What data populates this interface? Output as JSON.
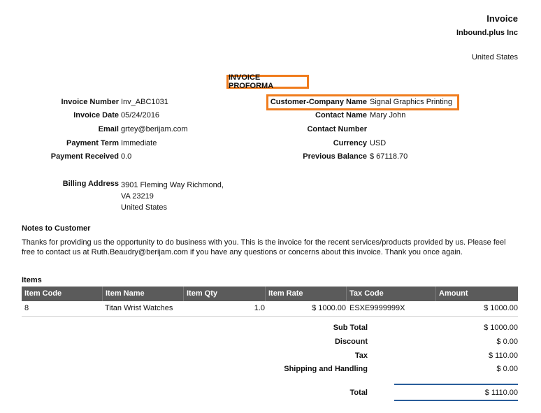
{
  "header": {
    "doc_title": "Invoice",
    "company_name": "Inbound.plus Inc",
    "company_country": "United States"
  },
  "proforma_title": "INVOICE PROFORMA",
  "left_fields": [
    {
      "label": "Invoice Number",
      "value": "Inv_ABC1031"
    },
    {
      "label": "Invoice Date",
      "value": "05/24/2016"
    },
    {
      "label": "Email",
      "value": "grtey@berijam.com"
    },
    {
      "label": "Payment Term",
      "value": "Immediate"
    },
    {
      "label": "Payment Received",
      "value": "0.0"
    }
  ],
  "right_fields": [
    {
      "label": "Customer-Company Name",
      "value": "Signal Graphics Printing"
    },
    {
      "label": "Contact Name",
      "value": "Mary John"
    },
    {
      "label": "Contact Number",
      "value": ""
    },
    {
      "label": "Currency",
      "value": "USD"
    },
    {
      "label": "Previous Balance",
      "value": "$ 67118.70"
    }
  ],
  "billing": {
    "label": "Billing Address",
    "line1": "3901 Fleming Way Richmond,",
    "line2": "VA 23219",
    "line3": "United States"
  },
  "notes": {
    "title": "Notes to Customer",
    "text": "Thanks for providing us the opportunity to do business with you. This is the invoice for the recent services/products provided by us. Please feel free to contact us at Ruth.Beaudry@berijam.com if you have any questions or concerns about this invoice. Thank you once again."
  },
  "items": {
    "title": "Items",
    "columns": [
      "Item Code",
      "Item Name",
      "Item Qty",
      "Item Rate",
      "Tax Code",
      "Amount"
    ],
    "rows": [
      {
        "code": "8",
        "name": "Titan Wrist Watches",
        "qty": "1.0",
        "rate": "$ 1000.00",
        "tax": "ESXE9999999X",
        "amount": "$ 1000.00"
      }
    ]
  },
  "summary": {
    "subtotal_label": "Sub Total",
    "subtotal": "$ 1000.00",
    "discount_label": "Discount",
    "discount": "$ 0.00",
    "tax_label": "Tax",
    "tax": "$ 110.00",
    "shipping_label": "Shipping and Handling",
    "shipping": "$ 0.00",
    "total_label": "Total",
    "total": "$ 1110.00"
  },
  "colors": {
    "highlight": "#f07c1d",
    "table_header": "#5b5b5b",
    "total_line": "#2a5d9a"
  }
}
